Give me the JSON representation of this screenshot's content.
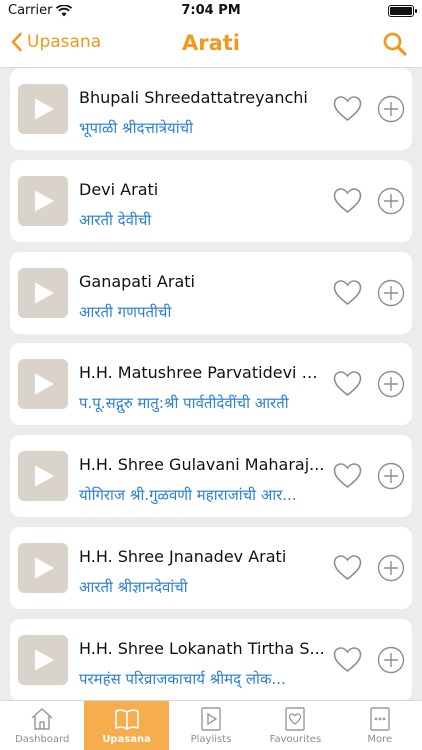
{
  "status": {
    "carrier": "Carrier",
    "time": "7:04 PM"
  },
  "nav": {
    "back_label": "Upasana",
    "title": "Arati"
  },
  "colors": {
    "accent": "#f0991c",
    "subtitle": "#2a7fd4",
    "tab_active_bg": "#f6ad4e"
  },
  "items": [
    {
      "title": "Bhupali Shreedattatreyanchi",
      "subtitle": "भूपाळी श्रीदत्तात्रेयांची"
    },
    {
      "title": "Devi Arati",
      "subtitle": "आरती देवीची"
    },
    {
      "title": "Ganapati Arati",
      "subtitle": "आरती गणपतीची"
    },
    {
      "title": "H.H. Matushree Parvatidevi A...",
      "subtitle": "प.पू.सद्गुरु मातु:श्री पार्वतीदेवींची आरती"
    },
    {
      "title": "H.H. Shree Gulavani Maharaj...",
      "subtitle": "योगिराज श्री.गुळवणी महाराजांची आर..."
    },
    {
      "title": "H.H. Shree Jnanadev Arati",
      "subtitle": "आरती श्रीज्ञानदेवांची"
    },
    {
      "title": "H.H. Shree Lokanath Tirtha S...",
      "subtitle": "परमहंस परिव्राजकाचार्य श्रीमद् लोक..."
    }
  ],
  "tabs": [
    {
      "label": "Dashboard",
      "icon": "home-icon"
    },
    {
      "label": "Upasana",
      "icon": "book-icon",
      "active": true
    },
    {
      "label": "Playlists",
      "icon": "playlist-icon"
    },
    {
      "label": "Favourites",
      "icon": "favourites-icon"
    },
    {
      "label": "More",
      "icon": "more-icon"
    }
  ]
}
